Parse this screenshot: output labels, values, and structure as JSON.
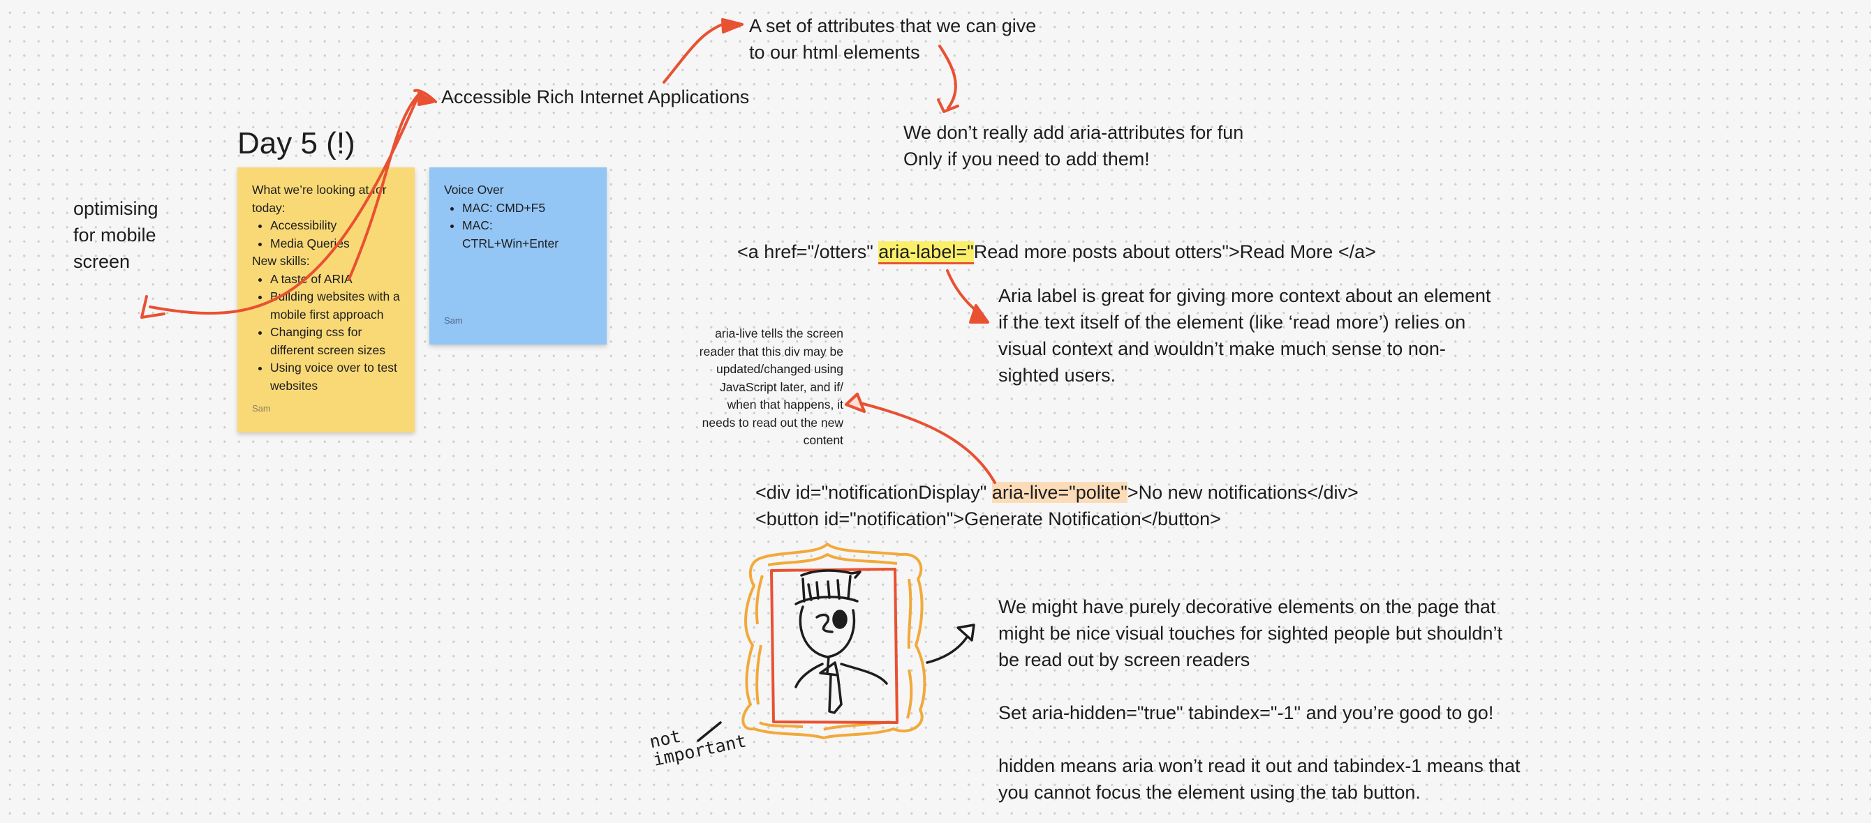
{
  "board": {
    "title": "Day 5 (!)",
    "side_note": [
      "optimising",
      "for mobile",
      "screen"
    ],
    "aria_heading": "Accessible Rich Internet Applications",
    "aria_definition": [
      "A set of attributes that we can give",
      "to our html elements"
    ],
    "aria_caution": [
      "We don’t really add aria-attributes for fun",
      "Only if you need to add them!"
    ],
    "aria_label_code": {
      "before": "<a href=\"/otters\" ",
      "highlight": "aria-label=\"",
      "after": "Read more posts about otters\">Read More </a>"
    },
    "aria_label_note": [
      "Aria label is great for giving more context about an element",
      "if the text itself of the element (like ‘read more’) relies on",
      "visual context and wouldn’t make much sense to non-",
      "sighted users."
    ],
    "aria_live_note": [
      "aria-live tells the screen",
      "reader that this div may be",
      "updated/changed using",
      "JavaScript later, and if/",
      "when that happens, it",
      "needs to read out the new",
      "content"
    ],
    "aria_live_code": {
      "line1_before": "<div id=\"notificationDisplay\" ",
      "line1_highlight": "aria-live=\"polite\"",
      "line1_after": ">No new notifications</div>",
      "line2": "<button id=\"notification\">Generate Notification</button>"
    },
    "decorative_note": {
      "p1": [
        "We might have purely decorative elements on the page that",
        "might be nice visual touches for sighted people but shouldn’t",
        "be read out by screen readers"
      ],
      "p2": "Set aria-hidden=\"true\" tabindex=\"-1\" and you’re good to go!",
      "p3": [
        "hidden means aria won’t read it out and tabindex-1 means that",
        "you cannot focus the element using the tab button."
      ]
    },
    "handwriting": [
      "not",
      "important"
    ]
  },
  "sticky_yellow": {
    "intro": "What we’re looking at for today:",
    "today": [
      "Accessibility",
      "Media Queries"
    ],
    "skills_label": "New skills:",
    "skills": [
      "A taste of ARIA",
      "Building websites with a mobile first approach",
      "Changing css for different screen sizes",
      "Using voice over to test websites"
    ],
    "author": "Sam",
    "color": "#f9d976"
  },
  "sticky_blue": {
    "title": "Voice Over",
    "items": [
      "MAC: CMD+F5",
      "MAC: CTRL+Win+Enter"
    ],
    "author": "Sam",
    "color": "#93c5f5"
  },
  "colors": {
    "arrow": "#e85132",
    "frame": "#f2a93b",
    "ink": "#1d1d1d"
  }
}
